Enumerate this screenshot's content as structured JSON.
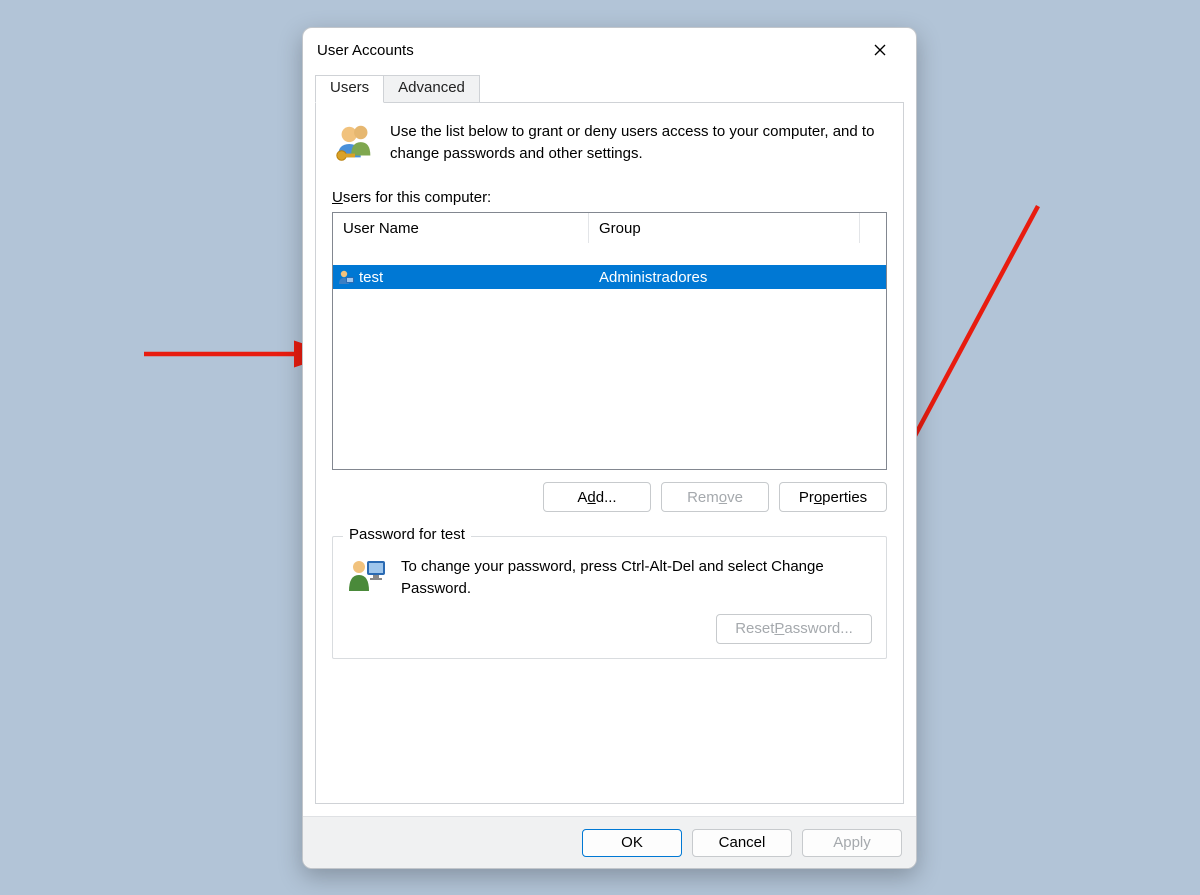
{
  "dialog": {
    "title": "User Accounts"
  },
  "tabs": {
    "users": "Users",
    "advanced": "Advanced"
  },
  "intro": "Use the list below to grant or deny users access to your computer, and to change passwords and other settings.",
  "list_label_pre": "U",
  "list_label_post": "sers for this computer:",
  "columns": {
    "name": "User Name",
    "group": "Group"
  },
  "users": [
    {
      "name": "test",
      "group": "Administradores",
      "selected": true
    }
  ],
  "buttons": {
    "add_pre": "A",
    "add_u": "d",
    "add_post": "d...",
    "remove_pre": "Rem",
    "remove_u": "o",
    "remove_post": "ve",
    "properties_pre": "Pr",
    "properties_u": "o",
    "properties_post": "perties"
  },
  "password_group": {
    "legend": "Password for test",
    "text": "To change your password, press Ctrl-Alt-Del and select Change Password.",
    "reset_pre": "Reset ",
    "reset_u": "P",
    "reset_post": "assword..."
  },
  "dialog_buttons": {
    "ok": "OK",
    "cancel": "Cancel",
    "apply_pre": "",
    "apply_u": "A",
    "apply_post": "pply"
  }
}
